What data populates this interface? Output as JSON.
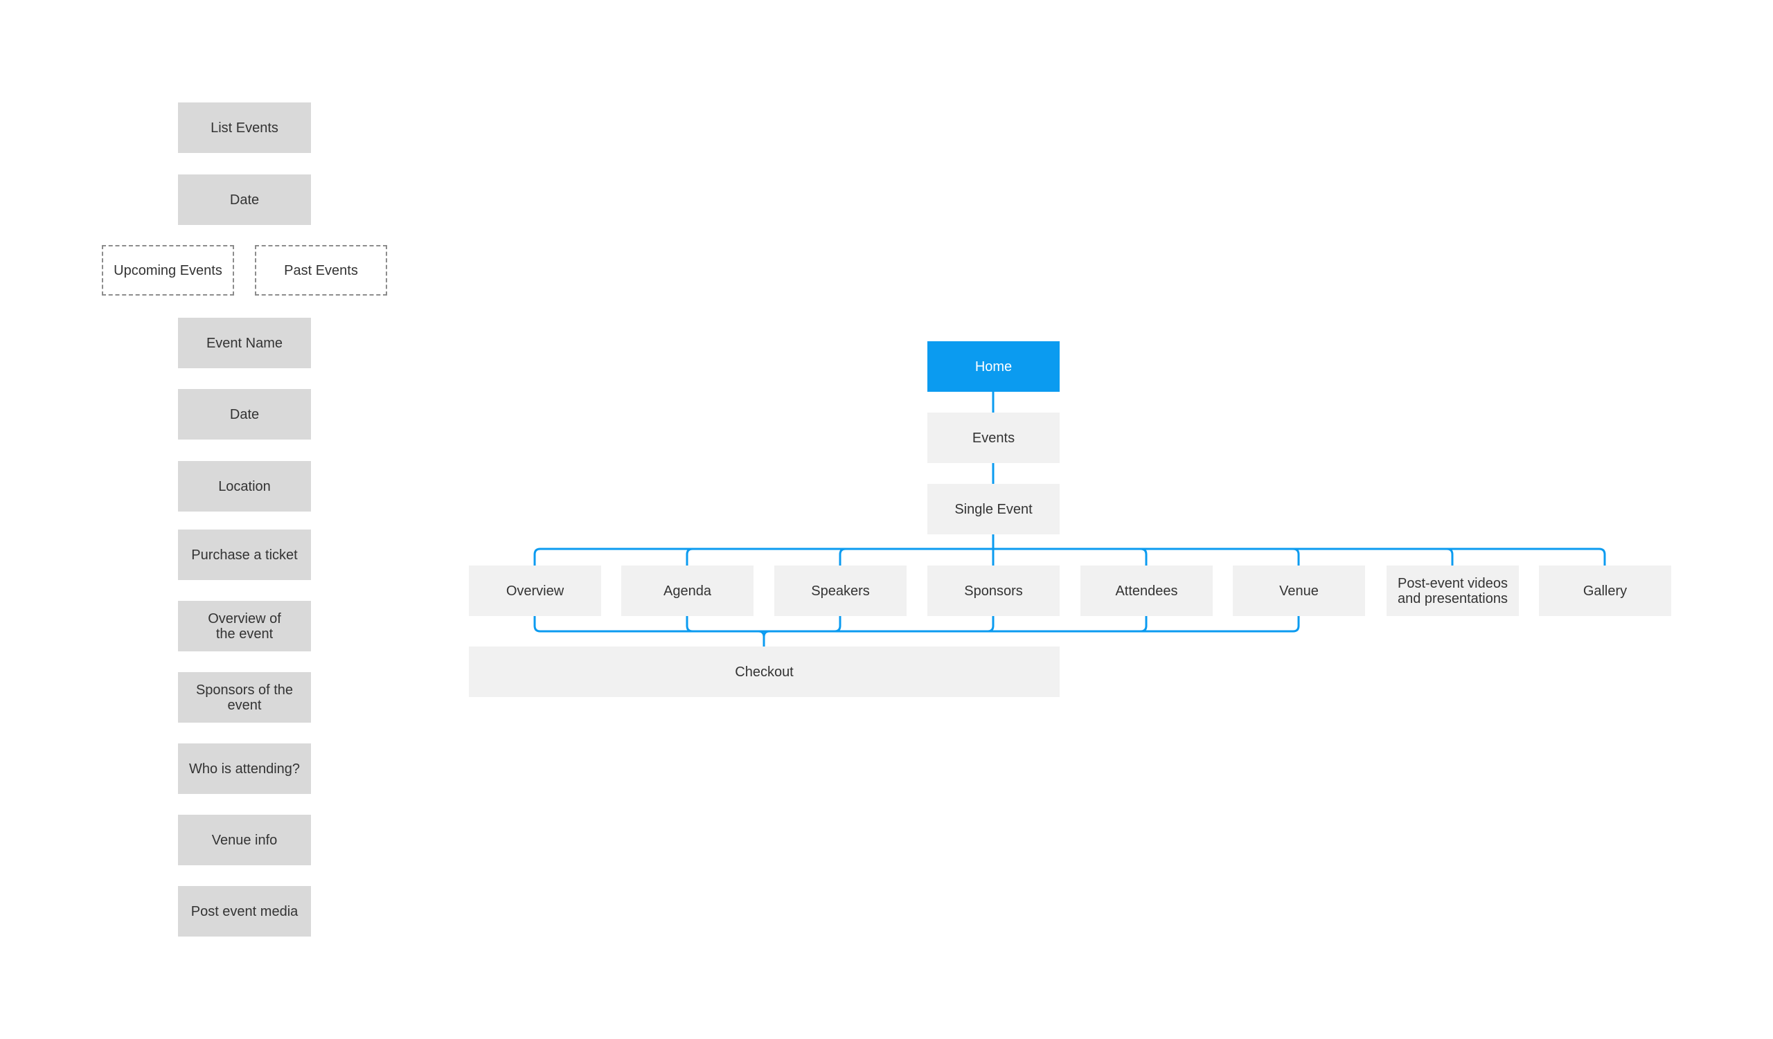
{
  "legend": {
    "items": [
      {
        "label": "List Events"
      },
      {
        "label": "Date"
      },
      {
        "label": "Event Name"
      },
      {
        "label": "Date"
      },
      {
        "label": "Location"
      },
      {
        "label": "Purchase a ticket"
      },
      {
        "label": "Overview of\nthe event"
      },
      {
        "label": "Sponsors of the\nevent"
      },
      {
        "label": "Who is attending?"
      },
      {
        "label": "Venue info"
      },
      {
        "label": "Post event media"
      }
    ],
    "filters": [
      {
        "label": "Upcoming Events"
      },
      {
        "label": "Past Events"
      }
    ]
  },
  "sitemap": {
    "accent_color": "#0b9bf0",
    "root": {
      "label": "Home"
    },
    "level1": {
      "label": "Events"
    },
    "level2": {
      "label": "Single Event"
    },
    "sections": [
      {
        "label": "Overview"
      },
      {
        "label": "Agenda"
      },
      {
        "label": "Speakers"
      },
      {
        "label": "Sponsors"
      },
      {
        "label": "Attendees"
      },
      {
        "label": "Venue"
      },
      {
        "label": "Post-event videos\nand presentations"
      },
      {
        "label": "Gallery"
      }
    ],
    "checkout": {
      "label": "Checkout"
    }
  }
}
